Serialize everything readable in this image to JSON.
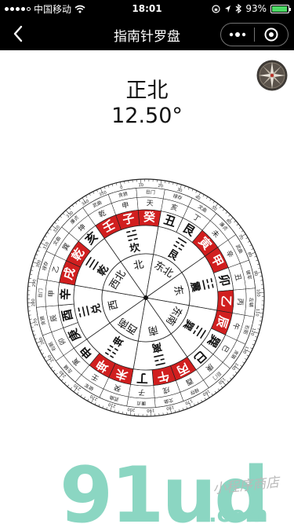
{
  "status_bar": {
    "carrier": "中国移动",
    "time": "18:01",
    "battery_percent": "93%",
    "battery_level": 0.93
  },
  "nav": {
    "title": "指南针罗盘",
    "back_icon": "chevron-left-icon",
    "more_icon": "more-dots-icon",
    "close_icon": "target-circle-icon"
  },
  "heading": {
    "direction": "正北",
    "degree": "12.50°"
  },
  "compass": {
    "center_directions": [
      "北",
      "东北",
      "东",
      "东南",
      "南",
      "西南",
      "西",
      "西北"
    ],
    "trigrams": [
      "坎",
      "艮",
      "震",
      "巽",
      "离",
      "坤",
      "兑",
      "乾"
    ],
    "trigram_symbols": [
      "☵",
      "☶",
      "☳",
      "☴",
      "☲",
      "☷",
      "☱",
      "☰"
    ],
    "mountains": [
      "壬",
      "子",
      "癸",
      "丑",
      "艮",
      "寅",
      "甲",
      "卯",
      "乙",
      "辰",
      "巽",
      "巳",
      "丙",
      "午",
      "丁",
      "未",
      "坤",
      "申",
      "庚",
      "酉",
      "辛",
      "戌",
      "乾",
      "亥"
    ],
    "red_mountains": [
      "壬",
      "子",
      "癸",
      "寅",
      "甲",
      "乙",
      "辰",
      "丙",
      "午",
      "未",
      "坤",
      "戌",
      "乾"
    ],
    "small_ring": [
      "申",
      "天",
      "亥",
      "丁",
      "未",
      "辛",
      "丑",
      "丙",
      "午",
      "巳",
      "庚",
      "酉",
      "戌",
      "子",
      "癸",
      "壬",
      "寅",
      "卯",
      "辰",
      "甲",
      "乙",
      "巽",
      "坤",
      "乾"
    ],
    "stars_ring": [
      "贪狼",
      "巨门",
      "禄存",
      "文曲",
      "廉贞",
      "武曲",
      "破军",
      "左辅",
      "右弼",
      "贪狼",
      "巨门",
      "禄存",
      "文曲",
      "廉贞",
      "武曲",
      "破军",
      "左辅",
      "右弼",
      "贪狼",
      "巨门",
      "禄存",
      "文曲",
      "廉贞",
      "武曲"
    ],
    "degree_labels": [
      "0",
      "10",
      "20",
      "30",
      "40",
      "50",
      "60",
      "70",
      "80",
      "90",
      "100",
      "110",
      "120",
      "130",
      "140",
      "150",
      "160",
      "170",
      "180",
      "190",
      "200",
      "210",
      "220",
      "230",
      "240",
      "250",
      "260",
      "270",
      "280",
      "290",
      "300",
      "310",
      "320",
      "330",
      "340",
      "350"
    ],
    "heading_degrees": 12.5
  },
  "watermark": {
    "logo": "91ud",
    "suffix": ".com",
    "slogan": "小程序商店"
  }
}
